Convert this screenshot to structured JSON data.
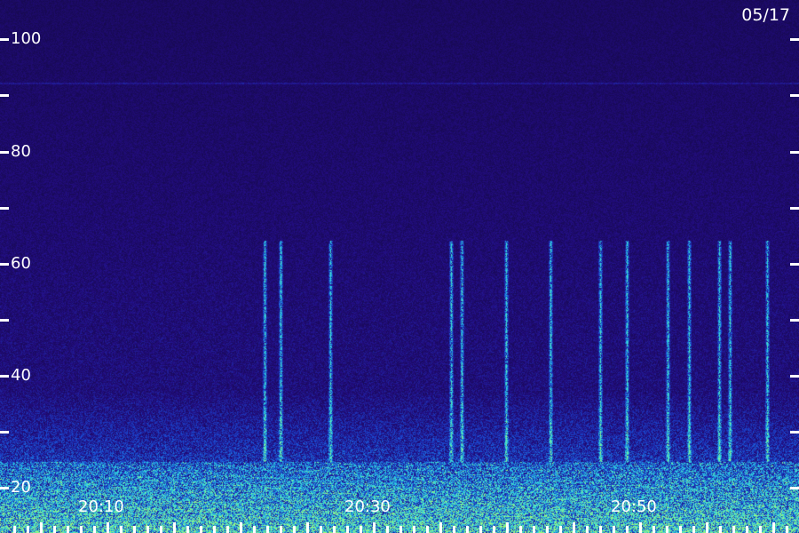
{
  "date_label": "05/17",
  "y_axis": {
    "labels": [
      "20",
      "40",
      "60",
      "80",
      "100"
    ],
    "tick_values": [
      20,
      30,
      40,
      50,
      60,
      70,
      80,
      90,
      100
    ],
    "range": [
      12,
      107
    ]
  },
  "x_axis": {
    "labels": [
      "20:10",
      "20:30",
      "20:50"
    ],
    "label_minutes": [
      10,
      30,
      50
    ],
    "range_minutes": [
      2,
      62
    ]
  },
  "colors": {
    "background": "#1a0a5a",
    "low_noise": "#22148a",
    "mid_noise": "#2a3ccf",
    "high_energy": "#3fd0e0",
    "peak": "#9af27a",
    "ticks_and_text": "#ffffff"
  }
}
